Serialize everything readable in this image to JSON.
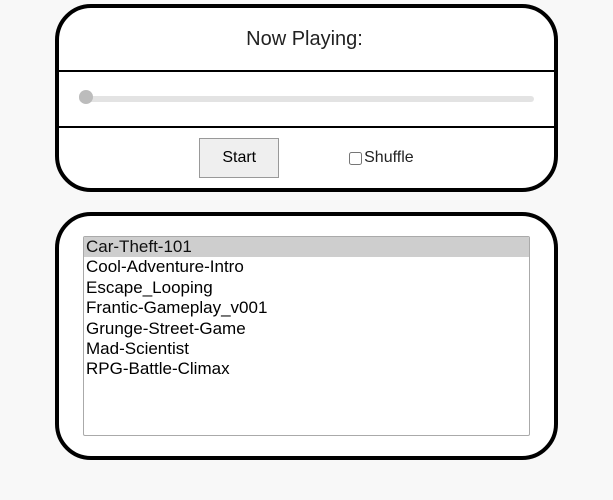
{
  "header": {
    "now_playing_label": "Now Playing:",
    "now_playing_value": ""
  },
  "slider": {
    "min": 0,
    "max": 100,
    "value": 0
  },
  "controls": {
    "start_label": "Start",
    "shuffle_label": "Shuffle",
    "shuffle_checked": false
  },
  "playlist": {
    "selected_index": 0,
    "items": [
      "Car-Theft-101",
      "Cool-Adventure-Intro",
      "Escape_Looping",
      "Frantic-Gameplay_v001",
      "Grunge-Street-Game",
      "Mad-Scientist",
      "RPG-Battle-Climax"
    ]
  }
}
